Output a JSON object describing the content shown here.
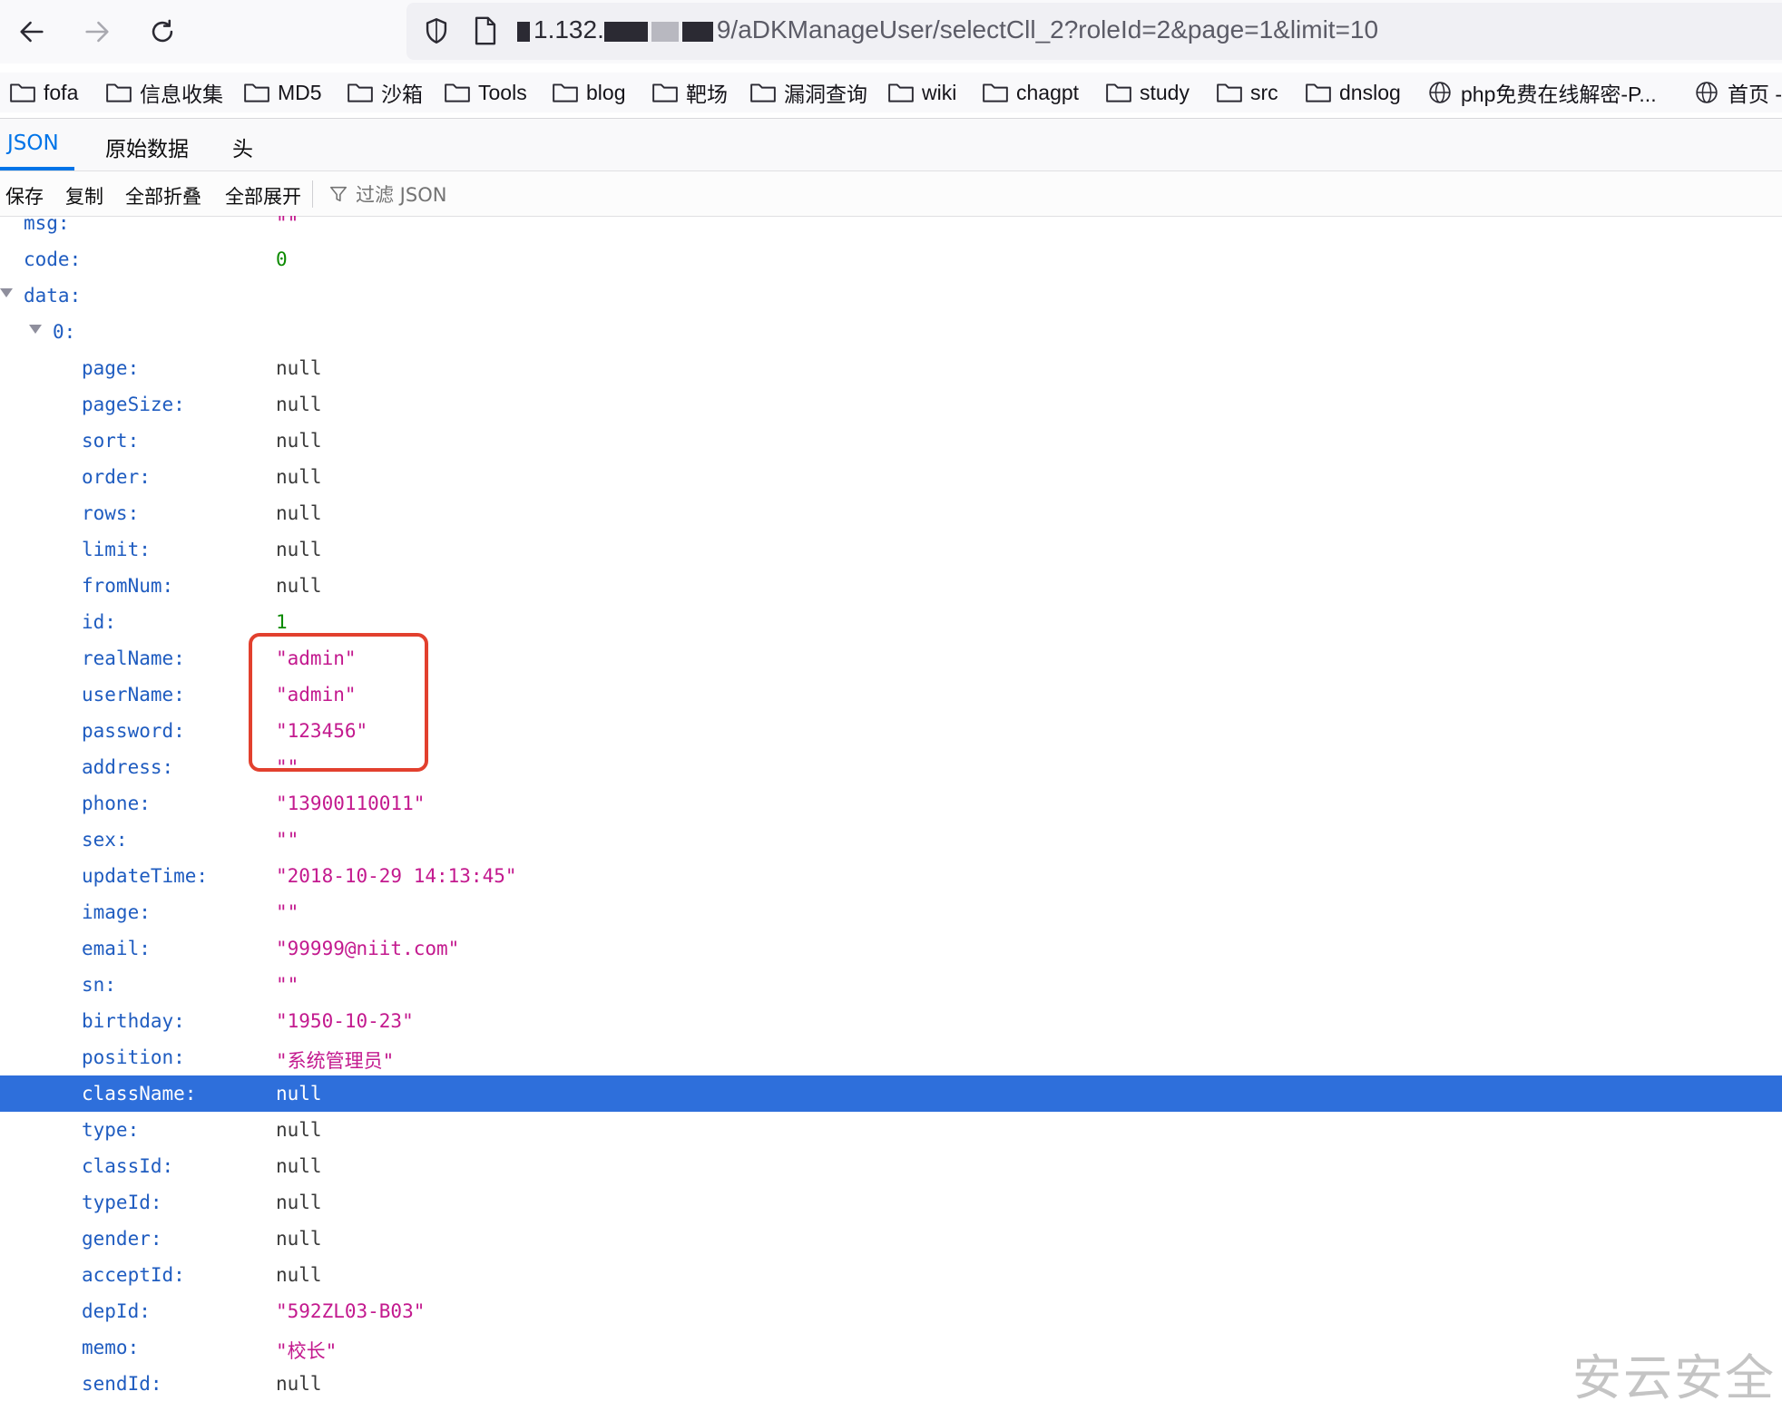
{
  "browser": {
    "url_visible": "9/aDKManageUser/selectCll_2?roleId=2&page=1&limit=10",
    "url_obscured_prefix": "1.132.",
    "icons": [
      "back-arrow-icon",
      "forward-arrow-icon",
      "reload-icon",
      "shield-icon",
      "page-icon"
    ]
  },
  "bookmarks": [
    {
      "label": "fofa",
      "icon": "folder-icon"
    },
    {
      "label": "信息收集",
      "icon": "folder-icon"
    },
    {
      "label": "MD5",
      "icon": "folder-icon"
    },
    {
      "label": "沙箱",
      "icon": "folder-icon"
    },
    {
      "label": "Tools",
      "icon": "folder-icon"
    },
    {
      "label": "blog",
      "icon": "folder-icon"
    },
    {
      "label": "靶场",
      "icon": "folder-icon"
    },
    {
      "label": "漏洞查询",
      "icon": "folder-icon"
    },
    {
      "label": "wiki",
      "icon": "folder-icon"
    },
    {
      "label": "chagpt",
      "icon": "folder-icon"
    },
    {
      "label": "study",
      "icon": "folder-icon"
    },
    {
      "label": "src",
      "icon": "folder-icon"
    },
    {
      "label": "dnslog",
      "icon": "folder-icon"
    },
    {
      "label": "php免费在线解密-P...",
      "icon": "globe-icon"
    },
    {
      "label": "首页 -",
      "icon": "globe-icon"
    }
  ],
  "viewer": {
    "tabs": [
      {
        "label": "JSON",
        "active": true
      },
      {
        "label": "原始数据",
        "active": false
      },
      {
        "label": "头",
        "active": false
      }
    ],
    "toolbar": {
      "save": "保存",
      "copy": "复制",
      "collapse_all": "全部折叠",
      "expand_all": "全部展开",
      "filter_placeholder": "过滤 JSON"
    }
  },
  "json_rows": [
    {
      "key": "msg:",
      "value": "\"\"",
      "type": "string",
      "indent": 0
    },
    {
      "key": "code:",
      "value": "0",
      "type": "number",
      "indent": 0
    },
    {
      "key": "data:",
      "value": "",
      "type": "object",
      "indent": 0,
      "expanded": true
    },
    {
      "key": "0:",
      "value": "",
      "type": "object",
      "indent": 1,
      "expanded": true
    },
    {
      "key": "page:",
      "value": "null",
      "type": "null",
      "indent": 2
    },
    {
      "key": "pageSize:",
      "value": "null",
      "type": "null",
      "indent": 2
    },
    {
      "key": "sort:",
      "value": "null",
      "type": "null",
      "indent": 2
    },
    {
      "key": "order:",
      "value": "null",
      "type": "null",
      "indent": 2
    },
    {
      "key": "rows:",
      "value": "null",
      "type": "null",
      "indent": 2
    },
    {
      "key": "limit:",
      "value": "null",
      "type": "null",
      "indent": 2
    },
    {
      "key": "fromNum:",
      "value": "null",
      "type": "null",
      "indent": 2
    },
    {
      "key": "id:",
      "value": "1",
      "type": "number",
      "indent": 2
    },
    {
      "key": "realName:",
      "value": "\"admin\"",
      "type": "string",
      "indent": 2
    },
    {
      "key": "userName:",
      "value": "\"admin\"",
      "type": "string",
      "indent": 2
    },
    {
      "key": "password:",
      "value": "\"123456\"",
      "type": "string",
      "indent": 2
    },
    {
      "key": "address:",
      "value": "\"\"",
      "type": "string",
      "indent": 2
    },
    {
      "key": "phone:",
      "value": "\"13900110011\"",
      "type": "string",
      "indent": 2
    },
    {
      "key": "sex:",
      "value": "\"\"",
      "type": "string",
      "indent": 2
    },
    {
      "key": "updateTime:",
      "value": "\"2018-10-29 14:13:45\"",
      "type": "string",
      "indent": 2
    },
    {
      "key": "image:",
      "value": "\"\"",
      "type": "string",
      "indent": 2
    },
    {
      "key": "email:",
      "value": "\"99999@niit.com\"",
      "type": "string",
      "indent": 2
    },
    {
      "key": "sn:",
      "value": "\"\"",
      "type": "string",
      "indent": 2
    },
    {
      "key": "birthday:",
      "value": "\"1950-10-23\"",
      "type": "string",
      "indent": 2
    },
    {
      "key": "position:",
      "value": "\"系统管理员\"",
      "type": "string",
      "indent": 2
    },
    {
      "key": "className:",
      "value": "null",
      "type": "null",
      "indent": 2,
      "selected": true
    },
    {
      "key": "type:",
      "value": "null",
      "type": "null",
      "indent": 2
    },
    {
      "key": "classId:",
      "value": "null",
      "type": "null",
      "indent": 2
    },
    {
      "key": "typeId:",
      "value": "null",
      "type": "null",
      "indent": 2
    },
    {
      "key": "gender:",
      "value": "null",
      "type": "null",
      "indent": 2
    },
    {
      "key": "acceptId:",
      "value": "null",
      "type": "null",
      "indent": 2
    },
    {
      "key": "depId:",
      "value": "\"592ZL03-B03\"",
      "type": "string",
      "indent": 2
    },
    {
      "key": "memo:",
      "value": "\"校长\"",
      "type": "string",
      "indent": 2
    },
    {
      "key": "sendId:",
      "value": "null",
      "type": "null",
      "indent": 2
    }
  ],
  "watermark": "安云安全",
  "colors": {
    "key": "#1f5cc0",
    "string": "#c3198e",
    "number": "#0b8a00",
    "selection": "#2e6fdb",
    "annotation_box": "#e2402e",
    "active_tab": "#0074e8"
  }
}
